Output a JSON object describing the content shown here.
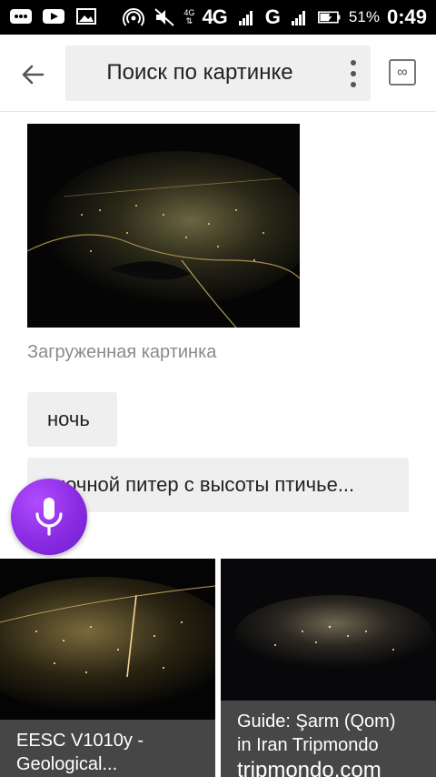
{
  "status_bar": {
    "network_small": "4G",
    "network": "4G",
    "network2": "G",
    "battery_percent": "51%",
    "time": "0:49"
  },
  "header": {
    "search_title": "Поиск по картинке"
  },
  "upload": {
    "caption": "Загруженная картинка"
  },
  "chips": [
    {
      "label": "ночь"
    },
    {
      "label": "ночной питер с высоты птичье..."
    }
  ],
  "results": [
    {
      "title_line1": "EESC V1010y -",
      "title_line2": "Geological..."
    },
    {
      "title_line1": "Guide: Şarm (Qom)",
      "title_line2": "in Iran Tripmondo",
      "source": "tripmondo.com"
    }
  ]
}
